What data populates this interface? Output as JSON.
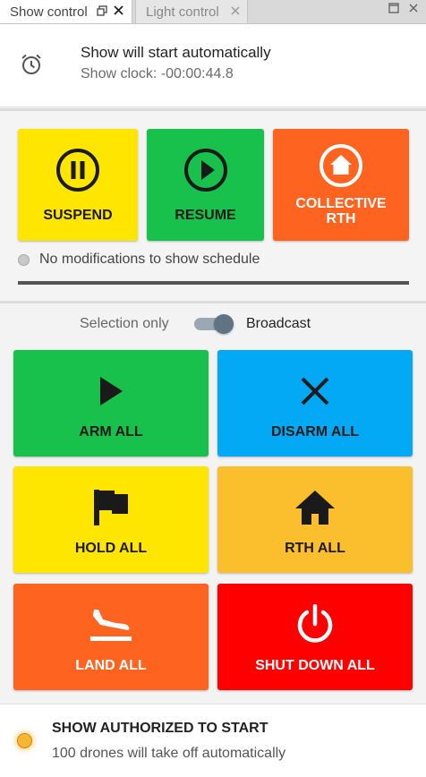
{
  "tabs": [
    {
      "label": "Show control",
      "active": true
    },
    {
      "label": "Light control",
      "active": false
    }
  ],
  "tab_icons": {
    "undock": "undock-icon",
    "close": "close-icon",
    "maximize": "maximize-icon"
  },
  "status": {
    "icon": "alarm-clock-icon",
    "title": "Show will start automatically",
    "clock": "Show clock: -00:00:44.8"
  },
  "show_buttons": {
    "suspend": {
      "label": "SUSPEND",
      "icon": "pause-circle-icon"
    },
    "resume": {
      "label": "RESUME",
      "icon": "play-circle-icon"
    },
    "collective_rth": {
      "label_line1": "COLLECTIVE",
      "label_line2": "RTH",
      "icon": "home-circle-icon"
    }
  },
  "schedule_status": "No modifications to show schedule",
  "selection": {
    "left": "Selection only",
    "right": "Broadcast",
    "broadcast_on": true
  },
  "grid_buttons": {
    "arm_all": {
      "label": "ARM ALL",
      "icon": "play-icon"
    },
    "disarm_all": {
      "label": "DISARM ALL",
      "icon": "close-icon"
    },
    "hold_all": {
      "label": "HOLD ALL",
      "icon": "flag-icon"
    },
    "rth_all": {
      "label": "RTH ALL",
      "icon": "home-icon"
    },
    "land_all": {
      "label": "LAND ALL",
      "icon": "landing-icon"
    },
    "shut_down_all": {
      "label": "SHUT DOWN ALL",
      "icon": "power-icon"
    }
  },
  "footer": {
    "title": "SHOW AUTHORIZED TO START",
    "subtitle": "100 drones will take off automatically"
  },
  "colors": {
    "yellow": "#ffe600",
    "green": "#18c04c",
    "orange": "#ff6320",
    "blue": "#03a9f4",
    "amber": "#fbbf2e",
    "red": "#ff0000"
  }
}
